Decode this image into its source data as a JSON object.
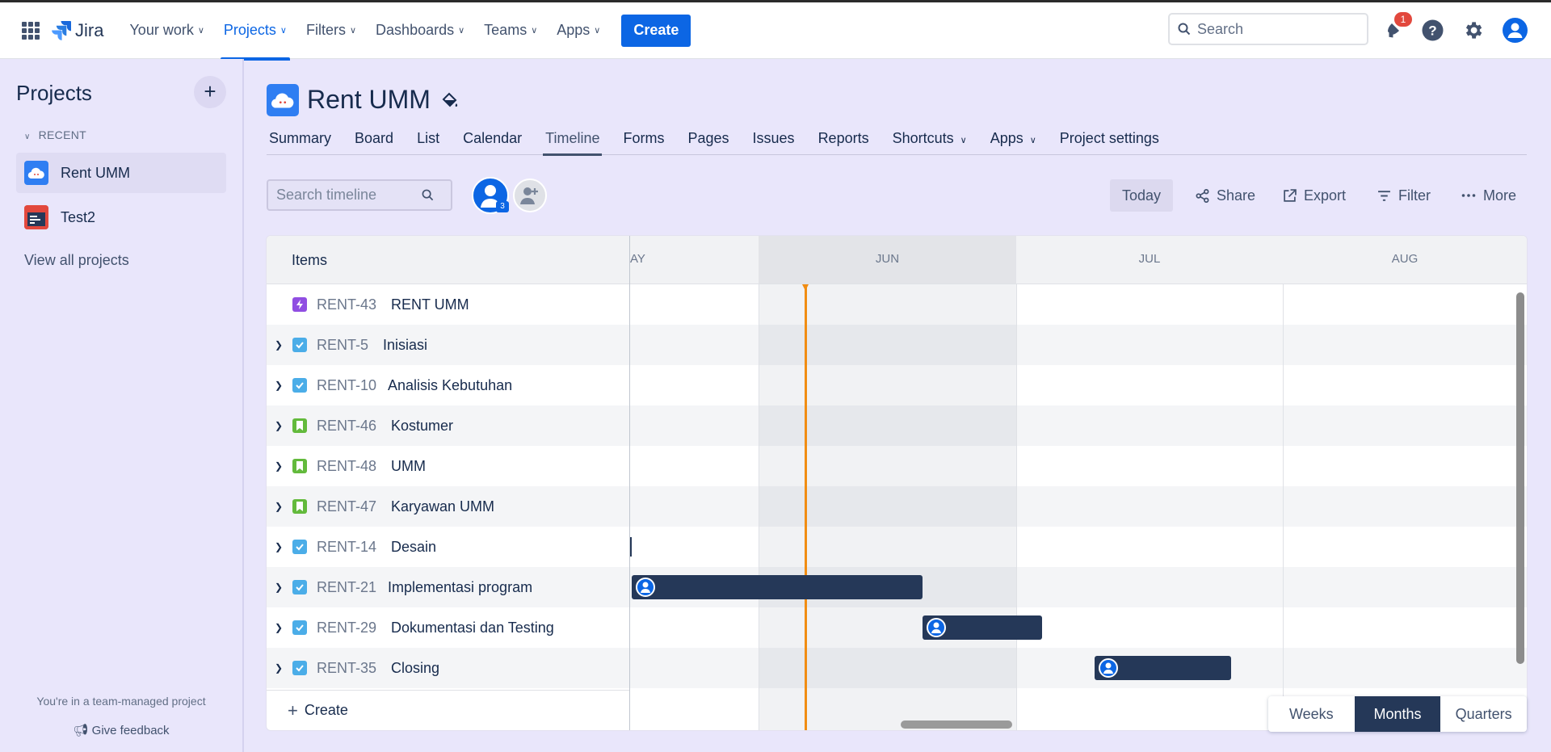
{
  "topnav": {
    "logo_text": "Jira",
    "items": [
      {
        "label": "Your work"
      },
      {
        "label": "Projects"
      },
      {
        "label": "Filters"
      },
      {
        "label": "Dashboards"
      },
      {
        "label": "Teams"
      },
      {
        "label": "Apps"
      }
    ],
    "create_label": "Create",
    "search_placeholder": "Search",
    "notification_count": "1"
  },
  "sidebar": {
    "title": "Projects",
    "recent_label": "RECENT",
    "projects": [
      {
        "name": "Rent UMM"
      },
      {
        "name": "Test2"
      }
    ],
    "view_all": "View all projects",
    "footer_note": "You're in a team-managed project",
    "feedback": "Give feedback"
  },
  "project": {
    "title": "Rent UMM",
    "tabs": [
      {
        "label": "Summary"
      },
      {
        "label": "Board"
      },
      {
        "label": "List"
      },
      {
        "label": "Calendar"
      },
      {
        "label": "Timeline"
      },
      {
        "label": "Forms"
      },
      {
        "label": "Pages"
      },
      {
        "label": "Issues"
      },
      {
        "label": "Reports"
      },
      {
        "label": "Shortcuts"
      },
      {
        "label": "Apps"
      },
      {
        "label": "Project settings"
      }
    ]
  },
  "toolbar": {
    "search_placeholder": "Search timeline",
    "avatar_count": "3",
    "today": "Today",
    "share": "Share",
    "export": "Export",
    "filter": "Filter",
    "more": "More"
  },
  "timeline": {
    "items_header": "Items",
    "months": [
      "AY",
      "JUN",
      "JUL",
      "AUG"
    ],
    "rows": [
      {
        "key": "RENT-43",
        "summary": "RENT UMM",
        "type": "epic",
        "expandable": false
      },
      {
        "key": "RENT-5",
        "summary": "Inisiasi",
        "type": "task",
        "expandable": true
      },
      {
        "key": "RENT-10",
        "summary": "Analisis Kebutuhan",
        "type": "task",
        "expandable": true
      },
      {
        "key": "RENT-46",
        "summary": "Kostumer",
        "type": "story",
        "expandable": true
      },
      {
        "key": "RENT-48",
        "summary": "UMM",
        "type": "story",
        "expandable": true
      },
      {
        "key": "RENT-47",
        "summary": "Karyawan UMM",
        "type": "story",
        "expandable": true
      },
      {
        "key": "RENT-14",
        "summary": "Desain",
        "type": "task",
        "expandable": true
      },
      {
        "key": "RENT-21",
        "summary": "Implementasi program",
        "type": "task",
        "expandable": true
      },
      {
        "key": "RENT-29",
        "summary": "Dokumentasi dan Testing",
        "type": "task",
        "expandable": true
      },
      {
        "key": "RENT-35",
        "summary": "Closing",
        "type": "task",
        "expandable": true
      }
    ],
    "create_label": "Create",
    "zoom_options": [
      "Weeks",
      "Months",
      "Quarters"
    ],
    "zoom_selected": "Months"
  },
  "colors": {
    "primary": "#0c66e4",
    "bar": "#253858",
    "today_line": "#f18d13",
    "epic": "#904ee2",
    "task": "#4bade8",
    "story": "#63ba3c",
    "badge": "#e2483d"
  }
}
